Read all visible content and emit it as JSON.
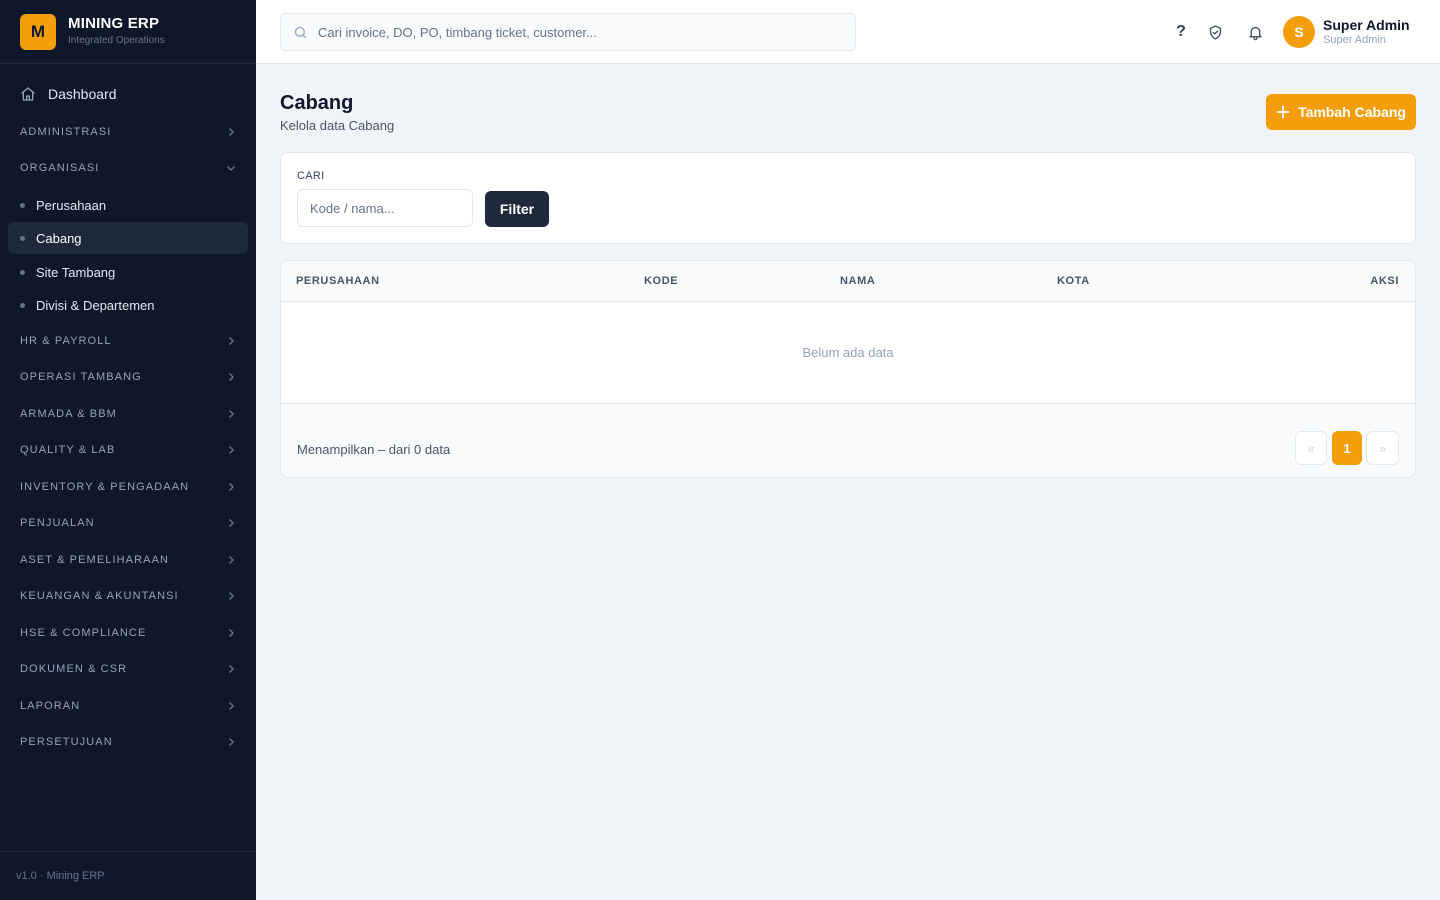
{
  "brand": {
    "logo_letter": "M",
    "title": "MINING ERP",
    "subtitle": "Integrated Operations"
  },
  "sidebar": {
    "dashboard": "Dashboard",
    "groups": {
      "administrasi": "ADMINISTRASI",
      "organisasi": "ORGANISASI",
      "hr_payroll": "HR & PAYROLL",
      "operasi_tambang": "OPERASI TAMBANG",
      "armada_bbm": "ARMADA & BBM",
      "quality_lab": "QUALITY & LAB",
      "inventory_pengadaan": "INVENTORY & PENGADAAN",
      "penjualan": "PENJUALAN",
      "aset_pemeliharaan": "ASET & PEMELIHARAAN",
      "keuangan_akuntansi": "KEUANGAN & AKUNTANSI",
      "hse_compliance": "HSE & COMPLIANCE",
      "dokumen_csr": "DOKUMEN & CSR",
      "laporan": "LAPORAN",
      "persetujuan": "PERSETUJUAN"
    },
    "organisasi_items": {
      "perusahaan": "Perusahaan",
      "cabang": "Cabang",
      "site_tambang": "Site Tambang",
      "divisi_departemen": "Divisi & Departemen"
    },
    "footer": "v1.0 · Mining ERP"
  },
  "topbar": {
    "search_placeholder": "Cari invoice, DO, PO, timbang ticket, customer...",
    "help_glyph": "?",
    "user": {
      "initial": "S",
      "name": "Super Admin",
      "role": "Super Admin"
    }
  },
  "page": {
    "title": "Cabang",
    "subtitle": "Kelola data Cabang",
    "add_button": "Tambah Cabang"
  },
  "filter": {
    "label": "CARI",
    "placeholder": "Kode / nama...",
    "button": "Filter"
  },
  "table": {
    "columns": {
      "perusahaan": "PERUSAHAAN",
      "kode": "KODE",
      "nama": "NAMA",
      "kota": "KOTA",
      "aksi": "AKSI"
    },
    "rows": [],
    "empty_message": "Belum ada data",
    "footer_info": "Menampilkan – dari 0 data",
    "pagination": {
      "prev": "«",
      "current": "1",
      "next": "»"
    }
  },
  "colors": {
    "accent": "#f59e0b",
    "sidebar_bg": "#0f172a",
    "dark_button": "#1e293b"
  }
}
